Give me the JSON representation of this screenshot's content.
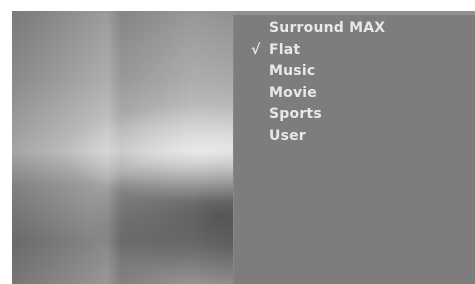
{
  "sound_menu": {
    "items": [
      {
        "label": "Surround MAX",
        "selected": false
      },
      {
        "label": "Flat",
        "selected": true
      },
      {
        "label": "Music",
        "selected": false
      },
      {
        "label": "Movie",
        "selected": false
      },
      {
        "label": "Sports",
        "selected": false
      },
      {
        "label": "User",
        "selected": false
      }
    ],
    "selected_mark": "√"
  },
  "colors": {
    "panel": "#7d7d7d",
    "text": "#e8e8e8"
  }
}
